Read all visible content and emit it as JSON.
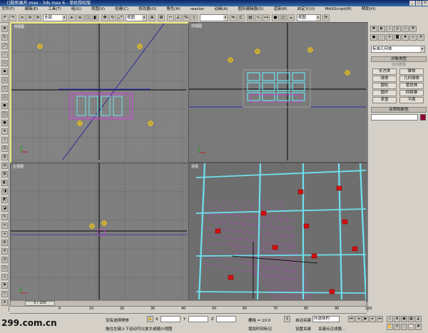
{
  "window": {
    "title": "[]鞋柜展开.max - 3ds max 6 - 单机授权版"
  },
  "menu": [
    "文件(F)",
    "编辑(E)",
    "工具(T)",
    "组(G)",
    "视图(V)",
    "创建(C)",
    "修改器(O)",
    "角色(H)",
    "reactor",
    "动画(A)",
    "图形编辑器(D)",
    "渲染(R)",
    "自定义(U)",
    "MAXScript(M)",
    "帮助(H)"
  ],
  "toolbar": {
    "selection_filter": "全部",
    "coord_system": "视图",
    "named_selection": "",
    "view_combo": "视图"
  },
  "viewports": {
    "top_label": "顶视图",
    "front_label": "前视图",
    "left_label": "左视图",
    "persp_label": "透视"
  },
  "command_panel": {
    "object_category": "标准几何体",
    "object_type_title": "对象类型",
    "autogrid_label": "自动栅格",
    "buttons": [
      "长方体",
      "锥体",
      "球体",
      "几何球体",
      "圆柱",
      "管状体",
      "圆环",
      "四棱锥",
      "茶壶",
      "平面"
    ],
    "name_color_title": "名称和颜色",
    "name_value": "",
    "color": "#990033"
  },
  "timeline": {
    "frame_display": "0 / 100",
    "ticks": [
      "0",
      "10",
      "20",
      "30",
      "40",
      "50",
      "60",
      "70",
      "80",
      "90",
      "100"
    ]
  },
  "status": {
    "selection_text": "没有选择物体",
    "prompt_text": "拖住左键上下运动可以放大或缩小视图",
    "x_label": "X",
    "y_label": "Y",
    "z_label": "Z",
    "grid_text": "栅格 = 10.0",
    "add_key_text": "增加时间标记",
    "auto_key": "自动关键",
    "set_key": "设置关键",
    "key_filter_combo": "所选择的",
    "key_filters": "关键点过滤器...",
    "watermark": "299.com.cn"
  },
  "colors": {
    "viewport_bg": "#7c7c7c",
    "active_border": "#e8e87a",
    "wire_magenta": "#d040e0",
    "wire_cyan": "#6ee0ee",
    "light_marker": "#ffd000"
  }
}
